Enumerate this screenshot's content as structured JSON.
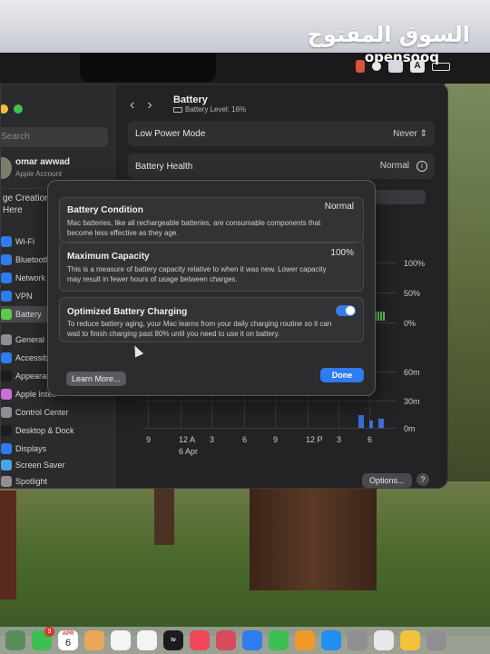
{
  "watermark": {
    "arabic": "السوق المفتوح",
    "latin": "opensooq"
  },
  "menubar": {
    "input_letter": "A"
  },
  "window": {
    "sidebar": {
      "search_placeholder": "Search",
      "user_name": "omar awwad",
      "user_sub": "Apple Account",
      "age_line1": "ge Creation",
      "age_line2": "Here",
      "items": [
        {
          "label": "Wi-Fi",
          "color": "#2f7bf0"
        },
        {
          "label": "Bluetooth",
          "color": "#2f7bf0"
        },
        {
          "label": "Network",
          "color": "#2f7bf0"
        },
        {
          "label": "VPN",
          "color": "#2f7bf0"
        },
        {
          "label": "Battery",
          "color": "#5fc94a"
        },
        {
          "label": "General",
          "color": "#8e8e93"
        },
        {
          "label": "Accessibili",
          "color": "#2f7bf0"
        },
        {
          "label": "Appearanc",
          "color": "#1c1c1e"
        },
        {
          "label": "Apple Intell",
          "color": "#c86fdc"
        },
        {
          "label": "Control Center",
          "color": "#8e8e93"
        },
        {
          "label": "Desktop & Dock",
          "color": "#1c1c1e"
        },
        {
          "label": "Displays",
          "color": "#2f7bf0"
        },
        {
          "label": "Screen Saver",
          "color": "#4aa3e6"
        },
        {
          "label": "Spotlight",
          "color": "#8e8e93"
        }
      ]
    },
    "header": {
      "title": "Battery",
      "subtitle": "Battery Level: 16%"
    },
    "rows": {
      "low_power_label": "Low Power Mode",
      "low_power_value": "Never",
      "health_label": "Battery Health",
      "health_value": "Normal"
    },
    "chart": {
      "y_top": [
        "100%",
        "50%",
        "0%"
      ],
      "y_bottom": [
        "60m",
        "30m",
        "0m"
      ],
      "x_labels": [
        "9",
        "12 A",
        "3",
        "6",
        "9",
        "12 P",
        "3",
        "6"
      ],
      "date_label": "6 Apr"
    },
    "options_label": "Options...",
    "help_label": "?"
  },
  "modal": {
    "condition_title": "Battery Condition",
    "condition_value": "Normal",
    "condition_desc": "Mac batteries, like all rechargeable batteries, are consumable components that become less effective as they age.",
    "capacity_title": "Maximum Capacity",
    "capacity_value": "100%",
    "capacity_desc": "This is a measure of battery capacity relative to when it was new. Lower capacity may result in fewer hours of usage between charges.",
    "optimized_title": "Optimized Battery Charging",
    "optimized_desc": "To reduce battery aging, your Mac learns from your daily charging routine so it can wait to finish charging past 80% until you need to use it on battery.",
    "optimized_on": true,
    "learn_more_label": "Learn More...",
    "done_label": "Done"
  },
  "dock": {
    "facetime_badge": "9",
    "calendar_month": "APR",
    "calendar_day": "6",
    "tv_label": "tv"
  }
}
